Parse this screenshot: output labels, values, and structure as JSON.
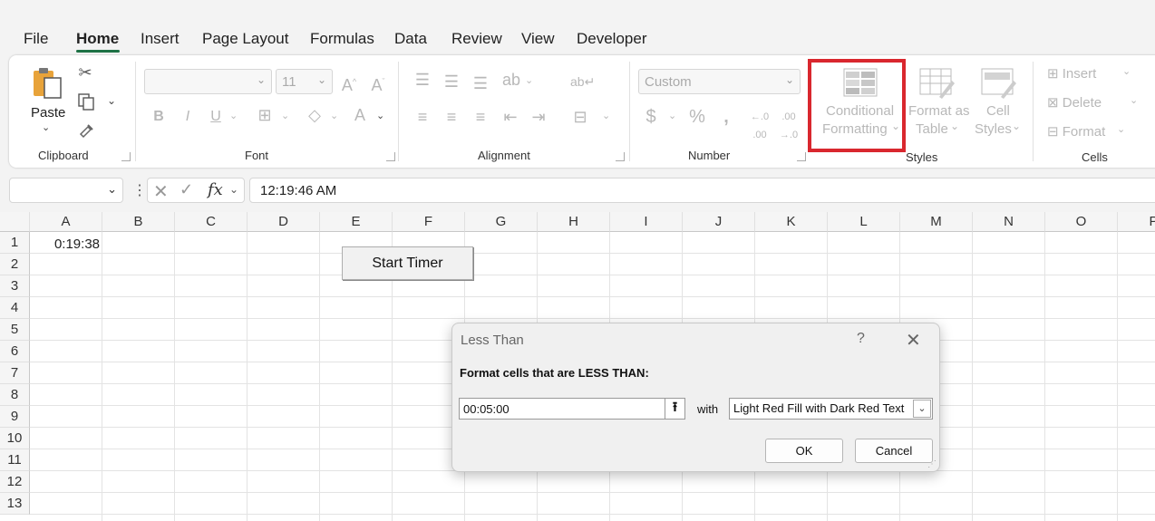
{
  "menu": {
    "tabs": [
      "File",
      "Home",
      "Insert",
      "Page Layout",
      "Formulas",
      "Data",
      "Review",
      "View",
      "Developer"
    ],
    "active": "Home"
  },
  "ribbon": {
    "clipboard": {
      "paste_label": "Paste",
      "group_label": "Clipboard"
    },
    "font": {
      "font_name": "",
      "font_size": "11",
      "group_label": "Font"
    },
    "alignment": {
      "group_label": "Alignment"
    },
    "number": {
      "format_value": "Custom",
      "group_label": "Number"
    },
    "styles": {
      "conditional_formatting_line1": "Conditional",
      "conditional_formatting_line2": "Formatting",
      "format_as_table_line1": "Format as",
      "format_as_table_line2": "Table",
      "cell_styles_line1": "Cell",
      "cell_styles_line2": "Styles",
      "group_label": "Styles"
    },
    "cells": {
      "insert_label": "Insert",
      "delete_label": "Delete",
      "format_label": "Format",
      "group_label": "Cells"
    }
  },
  "formula_bar": {
    "name_box": "",
    "fx_label": "fx",
    "value": "12:19:46 AM"
  },
  "sheet": {
    "columns": [
      "A",
      "B",
      "C",
      "D",
      "E",
      "F",
      "G",
      "H",
      "I",
      "J",
      "K",
      "L",
      "M",
      "N",
      "O",
      "P"
    ],
    "rows": [
      "1",
      "2",
      "3",
      "4",
      "5",
      "6",
      "7",
      "8",
      "9",
      "10",
      "11",
      "12",
      "13"
    ],
    "cell_a1": "0:19:38",
    "start_timer_button": "Start Timer"
  },
  "dialog": {
    "title": "Less Than",
    "help": "?",
    "close": "✕",
    "prompt": "Format cells that are LESS THAN:",
    "value": "00:05:00",
    "with_label": "with",
    "format_selected": "Light Red Fill with Dark Red Text",
    "ok_label": "OK",
    "cancel_label": "Cancel"
  },
  "colors": {
    "accent": "#1e7145",
    "highlight_box": "#d9272e"
  }
}
